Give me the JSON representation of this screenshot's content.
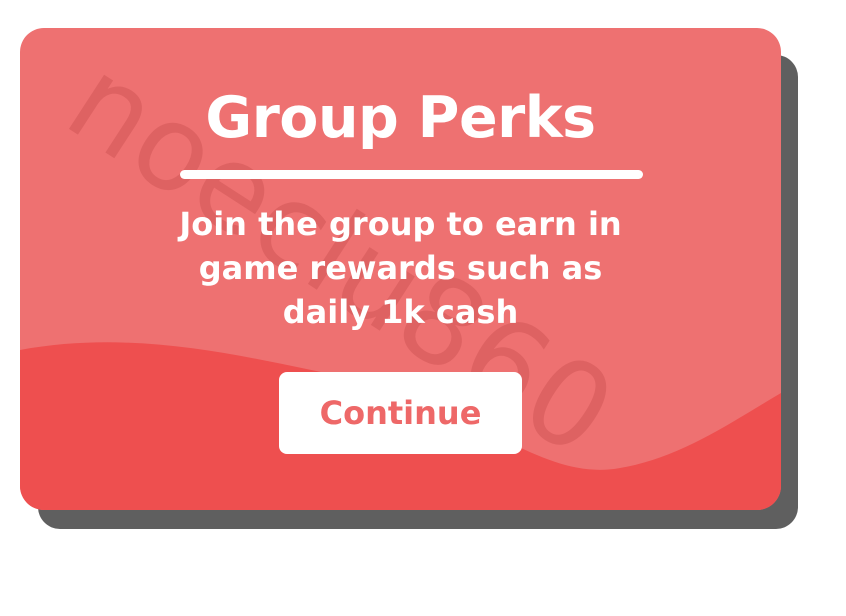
{
  "dialog": {
    "title": "Group Perks",
    "description_lines": [
      "Join the group to earn in",
      "game rewards such as",
      "daily 1k cash"
    ],
    "continue_label": "Continue",
    "watermark": "noeclu860"
  },
  "colors": {
    "card_top": "#ee7171",
    "card_bottom_wave": "#ee4f4f",
    "shadow": "#5f5f5f",
    "button_text": "#ee6868",
    "text": "#ffffff"
  }
}
